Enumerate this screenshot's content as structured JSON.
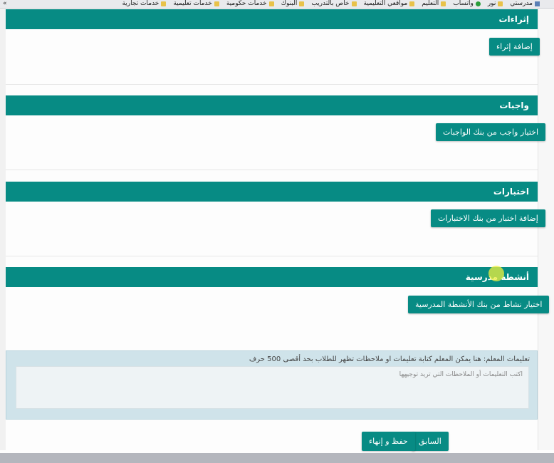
{
  "bookmarks": {
    "overflow": "»",
    "items": [
      {
        "label": "مدرستي",
        "icon": "site"
      },
      {
        "label": "نور",
        "icon": "folder"
      },
      {
        "label": "واتساب",
        "icon": "circle"
      },
      {
        "label": "التعليم",
        "icon": "folder"
      },
      {
        "label": "مواقعي التعليمية",
        "icon": "folder"
      },
      {
        "label": "خاص بالتدريب",
        "icon": "folder"
      },
      {
        "label": "البنوك",
        "icon": "folder"
      },
      {
        "label": "خدمات حكومية",
        "icon": "folder"
      },
      {
        "label": "خدمات تعليمية",
        "icon": "folder"
      },
      {
        "label": "خدمات تجارية",
        "icon": "folder"
      }
    ]
  },
  "sections": {
    "enrichments": {
      "title": "إثراءات",
      "button": "إضافة إثراء"
    },
    "homework": {
      "title": "واجبات",
      "button": "اختيار واجب من بنك الواجبات"
    },
    "tests": {
      "title": "اختبارات",
      "button": "إضافة اختبار من بنك الاختبارات"
    },
    "activities": {
      "title": "أنشطة مدرسية",
      "button": "اختيار نشاط من بنك الأنشطة المدرسية"
    }
  },
  "notes": {
    "label": "تعليمات المعلم: هنا يمكن المعلم كتابة تعليمات او ملاحظات تظهر للطلاب بحد أقصى 500 حرف",
    "placeholder": "اكتب التعليمات أو الملاحظات التي تريد توجيهها"
  },
  "footer": {
    "previous": "السابق",
    "save_finish": "حفظ و إنهاء"
  },
  "colors": {
    "accent": "#078b84",
    "notes_bg": "#cfe3ea"
  }
}
